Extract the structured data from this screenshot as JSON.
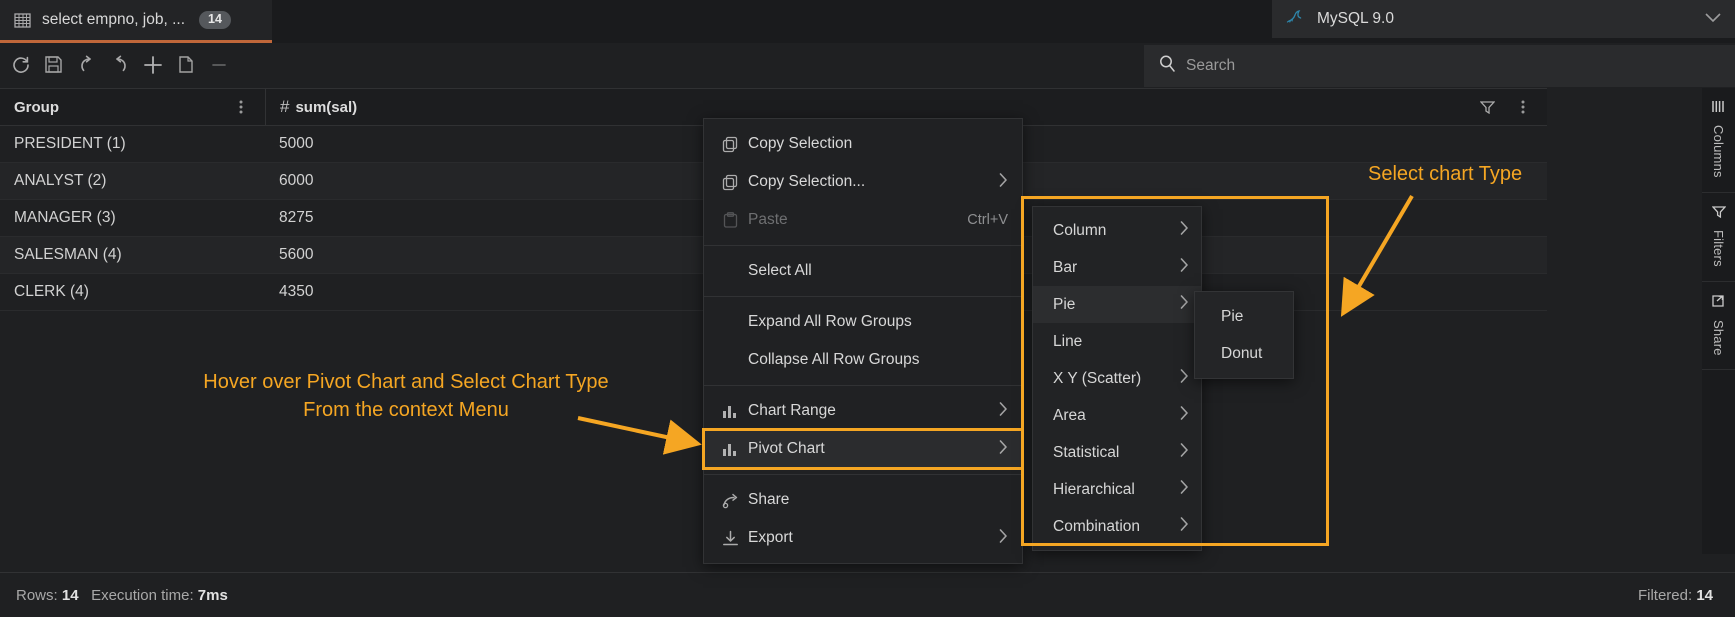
{
  "window": {
    "tab": {
      "title": "select empno, job, ...",
      "badge": "14",
      "icon": "grid-icon"
    },
    "database": {
      "label": "MySQL 9.0",
      "icon": "mysql-dolphin-icon",
      "caret": "chevron-down-icon"
    }
  },
  "toolbar": {
    "buttons": [
      {
        "name": "refresh-button",
        "icon": "refresh-icon",
        "enabled": true
      },
      {
        "name": "save-button",
        "icon": "floppy-disk-icon",
        "enabled": true
      },
      {
        "name": "undo-button",
        "icon": "undo-arrow-icon",
        "enabled": true
      },
      {
        "name": "redo-button",
        "icon": "redo-arrow-icon",
        "enabled": true
      },
      {
        "name": "add-row-button",
        "icon": "plus-icon",
        "enabled": true
      },
      {
        "name": "duplicate-row-button",
        "icon": "copy-page-icon",
        "enabled": true
      },
      {
        "name": "delete-row-button",
        "icon": "minus-icon",
        "enabled": false
      }
    ]
  },
  "search": {
    "placeholder": "Search",
    "value": "",
    "icon": "magnifier-icon"
  },
  "grid": {
    "columns": [
      {
        "label": "Group",
        "icon": null,
        "menu_icon": "kebab-menu-icon"
      },
      {
        "label": "sum(sal)",
        "icon": "hash-number-icon",
        "filter_icon": "funnel-icon",
        "menu_icon": "kebab-menu-icon"
      }
    ],
    "rows": [
      {
        "group": "PRESIDENT (1)",
        "sum": "5000"
      },
      {
        "group": "ANALYST (2)",
        "sum": "6000"
      },
      {
        "group": "MANAGER (3)",
        "sum": "8275"
      },
      {
        "group": "SALESMAN (4)",
        "sum": "5600"
      },
      {
        "group": "CLERK (4)",
        "sum": "4350"
      }
    ]
  },
  "sidebar": {
    "items": [
      {
        "label": "Columns",
        "icon": "columns-icon"
      },
      {
        "label": "Filters",
        "icon": "funnel-icon"
      },
      {
        "label": "Share",
        "icon": "share-export-icon"
      }
    ]
  },
  "status": {
    "rows_label": "Rows:",
    "rows_value": "14",
    "exec_label": "Execution time:",
    "exec_value": "7ms",
    "filtered_label": "Filtered:",
    "filtered_value": "14"
  },
  "context_menu": {
    "items": [
      {
        "label": "Copy Selection",
        "icon": "copy-icon",
        "shortcut": "",
        "arrow": false,
        "disabled": false,
        "highlight": false,
        "sep_after": false
      },
      {
        "label": "Copy Selection...",
        "icon": "copy-icon",
        "shortcut": "",
        "arrow": true,
        "disabled": false,
        "highlight": false,
        "sep_after": false
      },
      {
        "label": "Paste",
        "icon": "clipboard-icon",
        "shortcut": "Ctrl+V",
        "arrow": false,
        "disabled": true,
        "highlight": false,
        "sep_after": true
      },
      {
        "label": "Select All",
        "icon": null,
        "shortcut": "",
        "arrow": false,
        "disabled": false,
        "highlight": false,
        "sep_after": true
      },
      {
        "label": "Expand All Row Groups",
        "icon": null,
        "shortcut": "",
        "arrow": false,
        "disabled": false,
        "highlight": false,
        "sep_after": false
      },
      {
        "label": "Collapse All Row Groups",
        "icon": null,
        "shortcut": "",
        "arrow": false,
        "disabled": false,
        "highlight": false,
        "sep_after": true
      },
      {
        "label": "Chart Range",
        "icon": "bar-chart-icon",
        "shortcut": "",
        "arrow": true,
        "disabled": false,
        "highlight": false,
        "sep_after": false
      },
      {
        "label": "Pivot Chart",
        "icon": "bar-chart-icon",
        "shortcut": "",
        "arrow": true,
        "disabled": false,
        "highlight": true,
        "sep_after": true
      },
      {
        "label": "Share",
        "icon": "share-icon",
        "shortcut": "",
        "arrow": false,
        "disabled": false,
        "highlight": false,
        "sep_after": false
      },
      {
        "label": "Export",
        "icon": "download-icon",
        "shortcut": "",
        "arrow": true,
        "disabled": false,
        "highlight": false,
        "sep_after": false
      }
    ]
  },
  "chart_type_submenu": {
    "items": [
      {
        "label": "Column",
        "arrow": true,
        "active": false
      },
      {
        "label": "Bar",
        "arrow": true,
        "active": false
      },
      {
        "label": "Pie",
        "arrow": true,
        "active": true
      },
      {
        "label": "Line",
        "arrow": false,
        "active": false
      },
      {
        "label": "X Y (Scatter)",
        "arrow": true,
        "active": false
      },
      {
        "label": "Area",
        "arrow": true,
        "active": false
      },
      {
        "label": "Statistical",
        "arrow": true,
        "active": false
      },
      {
        "label": "Hierarchical",
        "arrow": true,
        "active": false
      },
      {
        "label": "Combination",
        "arrow": true,
        "active": false
      }
    ]
  },
  "pie_submenu": {
    "items": [
      {
        "label": "Pie"
      },
      {
        "label": "Donut"
      }
    ]
  },
  "annotations": {
    "left": "Hover over Pivot Chart and Select Chart Type\nFrom the context Menu",
    "right": "Select chart Type",
    "color": "#f5a623"
  }
}
